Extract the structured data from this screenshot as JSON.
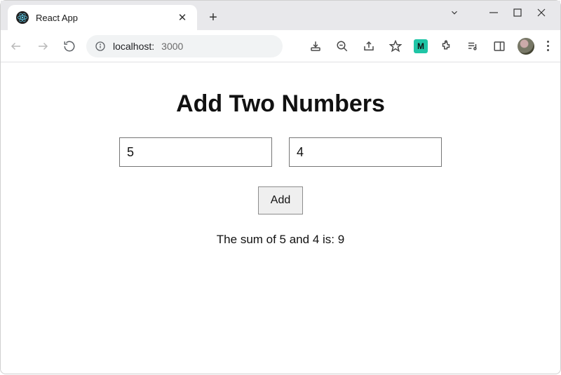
{
  "browser": {
    "tab_title": "React App",
    "url_host": "localhost:",
    "url_port": "3000"
  },
  "app": {
    "heading": "Add Two Numbers",
    "input1_value": "5",
    "input2_value": "4",
    "button_label": "Add",
    "result_text": "The sum of 5 and 4 is: 9"
  }
}
